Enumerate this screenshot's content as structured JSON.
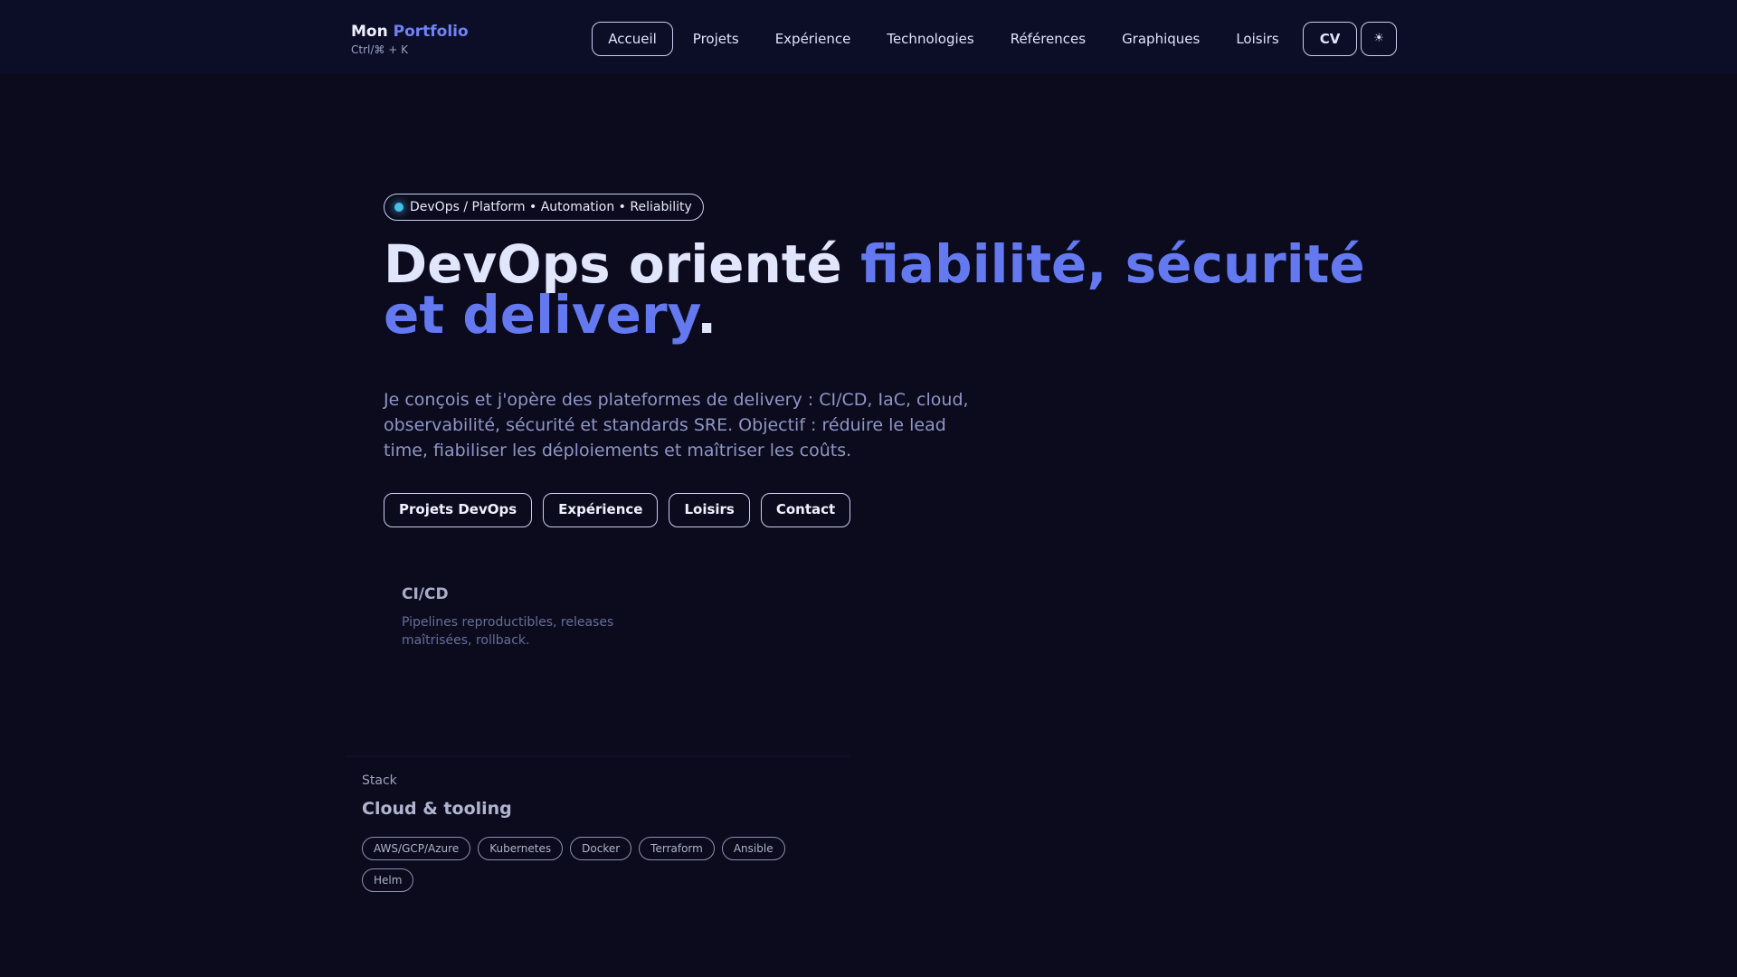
{
  "header": {
    "logo_first": "Mon",
    "logo_accent": "Portfolio",
    "shortcut": "Ctrl/⌘ + K",
    "nav": [
      "Accueil",
      "Projets",
      "Expérience",
      "Technologies",
      "Références",
      "Graphiques",
      "Loisirs"
    ],
    "cv_label": "CV",
    "theme_icon": "☀"
  },
  "hero": {
    "badge": "DevOps / Platform • Automation • Reliability",
    "title_plain": "DevOps orienté ",
    "title_accent": "fiabilité, sécurité et delivery",
    "title_end": ".",
    "lead": "Je conçois et j'opère des plateformes de delivery : CI/CD, IaC, cloud, observabilité, sécurité et standards SRE. Objectif : réduire le lead time, fiabiliser les déploiements et maîtriser les coûts.",
    "buttons": [
      "Projets DevOps",
      "Expérience",
      "Loisirs",
      "Contact"
    ]
  },
  "feature": {
    "title": "CI/CD",
    "desc": "Pipelines reproductibles, releases maîtrisées, rollback."
  },
  "stack": {
    "kicker": "Stack",
    "title": "Cloud & tooling",
    "tags": [
      "AWS/GCP/Azure",
      "Kubernetes",
      "Docker",
      "Terraform",
      "Ansible",
      "Helm"
    ]
  }
}
